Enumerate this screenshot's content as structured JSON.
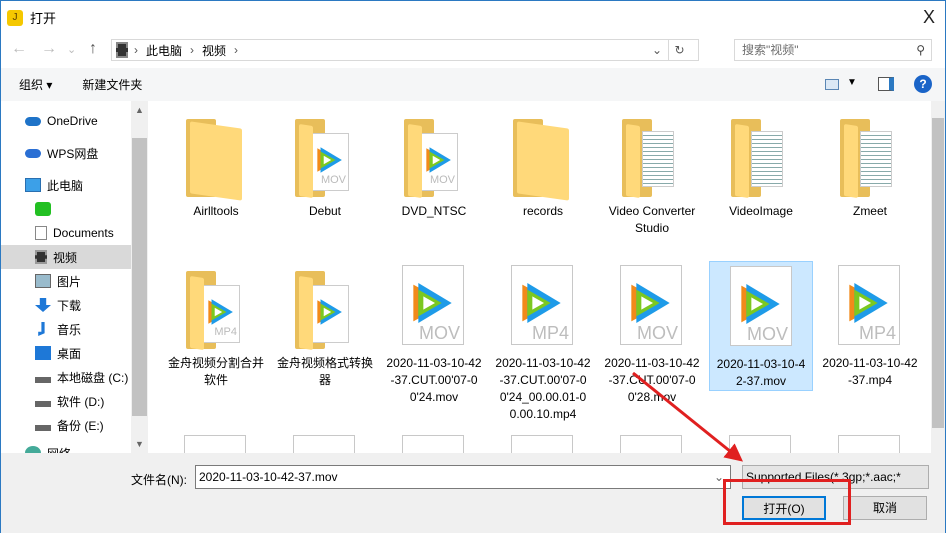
{
  "window": {
    "title": "打开",
    "app_icon": "app-logo-icon",
    "close": "X"
  },
  "nav": {
    "back": "←",
    "forward": "→",
    "recent": "⌄",
    "up": "↑",
    "breadcrumb": [
      "此电脑",
      "视频"
    ],
    "search_placeholder": "搜索\"视频\""
  },
  "toolbar": {
    "organize": "组织 ▾",
    "new_folder": "新建文件夹"
  },
  "sidebar": {
    "items": [
      {
        "label": "OneDrive",
        "icon": "cloud-icon"
      },
      {
        "label": "WPS网盘",
        "icon": "wps-cloud-icon"
      },
      {
        "label": "此电脑",
        "icon": "computer-icon"
      },
      {
        "label": "",
        "icon": "iqiyi-icon"
      },
      {
        "label": "Documents",
        "icon": "document-icon"
      },
      {
        "label": "视频",
        "icon": "video-folder-icon",
        "selected": true
      },
      {
        "label": "图片",
        "icon": "pictures-icon"
      },
      {
        "label": "下载",
        "icon": "download-icon"
      },
      {
        "label": "音乐",
        "icon": "music-icon"
      },
      {
        "label": "桌面",
        "icon": "desktop-icon"
      },
      {
        "label": "本地磁盘 (C:)",
        "icon": "drive-icon"
      },
      {
        "label": "软件 (D:)",
        "icon": "drive-icon"
      },
      {
        "label": "备份 (E:)",
        "icon": "drive-icon"
      },
      {
        "label": "网络",
        "icon": "network-icon"
      }
    ]
  },
  "files": [
    {
      "name": "Airlltools",
      "type": "folder"
    },
    {
      "name": "Debut",
      "type": "folder-video",
      "ext": "MOV"
    },
    {
      "name": "DVD_NTSC",
      "type": "folder-video",
      "ext": "MOV"
    },
    {
      "name": "records",
      "type": "folder"
    },
    {
      "name": "Video Converter Studio",
      "type": "folder-doc"
    },
    {
      "name": "VideoImage",
      "type": "folder-doc"
    },
    {
      "name": "Zmeet",
      "type": "folder-doc"
    },
    {
      "name": "金舟视频分割合并软件",
      "type": "folder-video",
      "ext": "MP4"
    },
    {
      "name": "金舟视频格式转换器",
      "type": "folder-video",
      "ext": ""
    },
    {
      "name": "2020-11-03-10-42-37.CUT.00'07-00'24.mov",
      "type": "video",
      "ext": "MOV"
    },
    {
      "name": "2020-11-03-10-42-37.CUT.00'07-00'24_00.00.01-00.00.10.mp4",
      "type": "video",
      "ext": "MP4"
    },
    {
      "name": "2020-11-03-10-42-37.CUT.00'07-00'28.mov",
      "type": "video",
      "ext": "MOV"
    },
    {
      "name": "2020-11-03-10-42-37.mov",
      "type": "video",
      "ext": "MOV",
      "selected": true
    },
    {
      "name": "2020-11-03-10-42-37.mp4",
      "type": "video",
      "ext": "MP4"
    }
  ],
  "footer": {
    "filename_label": "文件名(N):",
    "filename_value": "2020-11-03-10-42-37.mov",
    "filetype": "Supported Files(*.3gp;*.aac;*",
    "open": "打开(O)",
    "cancel": "取消"
  },
  "colors": {
    "accent": "#0078d7",
    "selection": "#cce8ff",
    "annotation": "#e02020"
  }
}
